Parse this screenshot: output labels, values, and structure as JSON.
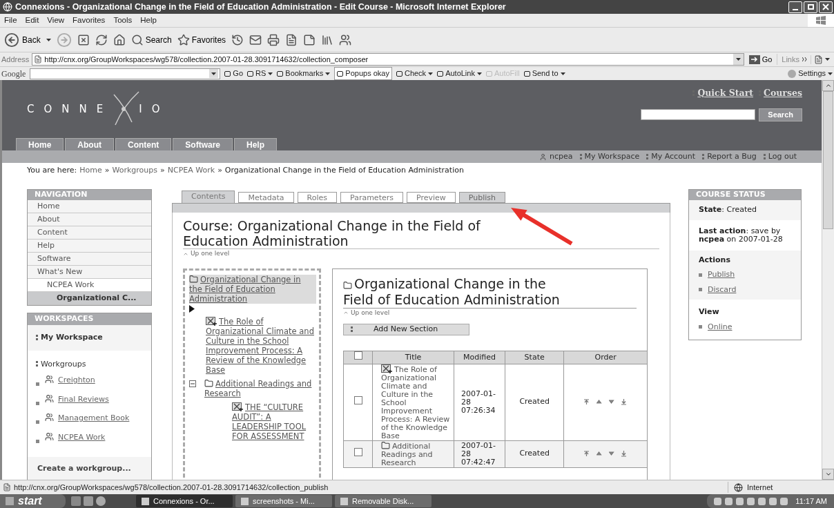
{
  "window": {
    "title": "Connexions - Organizational Change in the Field of Education Administration - Edit Course - Microsoft Internet Explorer"
  },
  "menu": [
    "File",
    "Edit",
    "View",
    "Favorites",
    "Tools",
    "Help"
  ],
  "toolbar": {
    "back": "Back",
    "search": "Search",
    "favorites": "Favorites"
  },
  "address": {
    "label": "Address",
    "value": "http://cnx.org/GroupWorkspaces/wg578/collection.2007-01-28.3091714632/collection_composer",
    "go": "Go",
    "links": "Links"
  },
  "google_bar": {
    "brand": "Google",
    "items": [
      {
        "label": "Go",
        "menu": false,
        "disabled": false
      },
      {
        "label": "RS",
        "menu": true,
        "disabled": false
      },
      {
        "label": "Bookmarks",
        "menu": true,
        "disabled": false
      },
      {
        "label": "Popups okay",
        "menu": false,
        "disabled": false
      },
      {
        "label": "Check",
        "menu": true,
        "disabled": false
      },
      {
        "label": "AutoLink",
        "menu": true,
        "disabled": false
      },
      {
        "label": "AutoFill",
        "menu": false,
        "disabled": true
      },
      {
        "label": "Send to",
        "menu": true,
        "disabled": false
      }
    ],
    "settings": "Settings"
  },
  "site": {
    "logo_left": "CONNE",
    "logo_right": "IO",
    "quick_links": [
      "Quick Start",
      "Courses"
    ],
    "search_button": "Search"
  },
  "nav_tabs": [
    "Home",
    "About",
    "Content",
    "Software",
    "Help"
  ],
  "user_links": [
    "ncpea",
    "My Workspace",
    "My Account",
    "Report a Bug",
    "Log out"
  ],
  "breadcrumb": {
    "label": "You are here:",
    "separator": "»",
    "items": [
      {
        "text": "Home",
        "link": true
      },
      {
        "text": "Workgroups",
        "link": true
      },
      {
        "text": "NCPEA Work",
        "link": true
      },
      {
        "text": "Organizational Change in the Field of Education Administration",
        "link": false
      }
    ]
  },
  "navigation": {
    "title": "NAVIGATION",
    "items": [
      {
        "label": "Home",
        "selected": false
      },
      {
        "label": "About",
        "selected": false
      },
      {
        "label": "Content",
        "selected": false
      },
      {
        "label": "Help",
        "selected": false
      },
      {
        "label": "Software",
        "selected": false
      },
      {
        "label": "What's New",
        "selected": false,
        "children": [
          {
            "label": "NCPEA Work",
            "selected": false,
            "children": [
              {
                "label": "Organizational C...",
                "selected": true
              }
            ]
          }
        ]
      }
    ]
  },
  "workspaces": {
    "title": "WORKSPACES",
    "my_workspace": "My Workspace",
    "workgroups_label": "Workgroups",
    "groups": [
      "Creighton",
      "Final Reviews",
      "Management Book",
      "NCPEA Work"
    ],
    "create": "Create a workgroup..."
  },
  "edit_tabs": [
    {
      "label": "Contents",
      "selected": true,
      "hovered": false
    },
    {
      "label": "Metadata",
      "selected": false,
      "hovered": false
    },
    {
      "label": "Roles",
      "selected": false,
      "hovered": false
    },
    {
      "label": "Parameters",
      "selected": false,
      "hovered": false
    },
    {
      "label": "Preview",
      "selected": false,
      "hovered": false
    },
    {
      "label": "Publish",
      "selected": false,
      "hovered": true
    }
  ],
  "course_heading": "Course: Organizational Change in the Field of Education Administration",
  "up_one_level": "Up one level",
  "tree": {
    "label": "Organizational Change in the Field of Education Administration",
    "selected": true,
    "children": [
      {
        "kind": "module",
        "label": "The Role of Organizational Climate and Culture in the School Improvement Process: A Review of the Knowledge Base"
      },
      {
        "kind": "folder",
        "label": "Additional Readings and Research",
        "expanded": true,
        "children": [
          {
            "kind": "module",
            "label": "THE “CULTURE AUDIT”: A LEADERSHIP TOOL FOR ASSESSMENT"
          }
        ]
      }
    ]
  },
  "collection": {
    "title": "Organizational Change in the Field of Education Administration",
    "up": "Up one level",
    "add_section": "Add New Section",
    "select_all_checked": false,
    "columns": [
      "Title",
      "Modified",
      "State",
      "Order"
    ],
    "rows": [
      {
        "kind": "module",
        "title": "The Role of Organizational Climate and Culture in the School Improvement Process: A Review of the Knowledge Base",
        "modified": "2007-01-28 07:26:34",
        "state": "Created",
        "checked": false
      },
      {
        "kind": "folder",
        "title": "Additional Readings and Research",
        "modified": "2007-01-28 07:42:47",
        "state": "Created",
        "checked": false
      }
    ]
  },
  "course_status": {
    "title": "COURSE STATUS",
    "state": "**State**: Created",
    "last_action": "**Last action**: save by **ncpea** on 2007-01-28",
    "actions_title": "Actions",
    "actions": [
      "Publish",
      "Discard"
    ],
    "view_title": "View",
    "view": [
      "Online"
    ]
  },
  "status_bar": {
    "url": "http://cnx.org/GroupWorkspaces/wg578/collection.2007-01-28.3091714632/collection_publish",
    "zone": "Internet"
  },
  "taskbar": {
    "start": "start",
    "tasks": [
      {
        "label": "Connexions - Or...",
        "selected": true
      },
      {
        "label": "screenshots - Mi...",
        "selected": false
      },
      {
        "label": "Removable Disk...",
        "selected": false
      }
    ],
    "clock": "11:17 AM"
  }
}
